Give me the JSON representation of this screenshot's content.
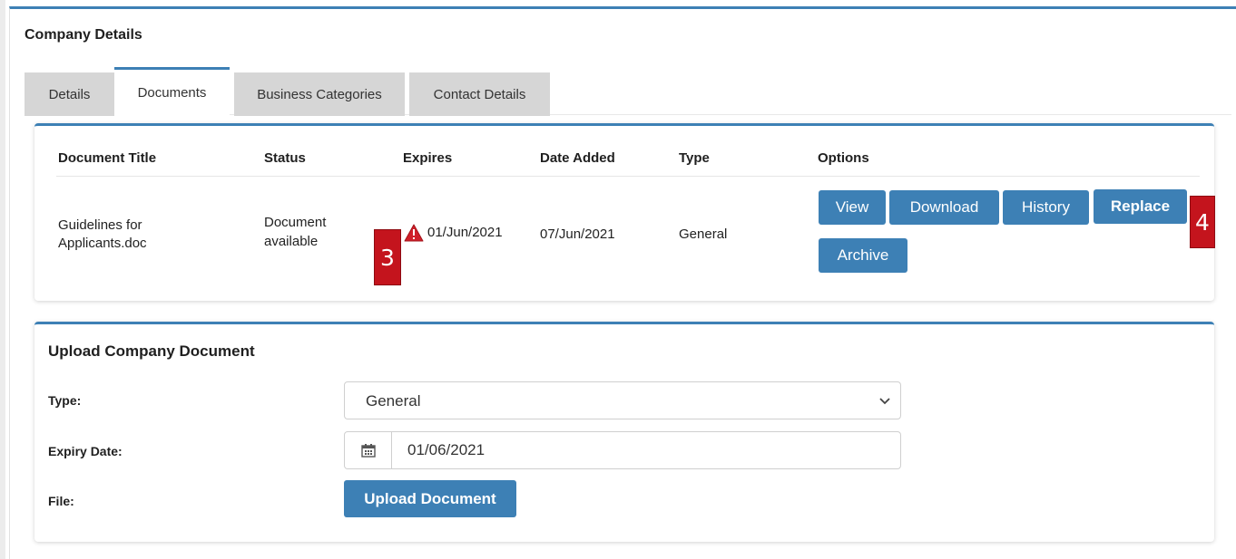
{
  "panel": {
    "title": "Company Details"
  },
  "tabs": [
    {
      "label": "Details",
      "active": false
    },
    {
      "label": "Documents",
      "active": true
    },
    {
      "label": "Business Categories",
      "active": false
    },
    {
      "label": "Contact Details",
      "active": false
    }
  ],
  "documents_table": {
    "headers": [
      "Document Title",
      "Status",
      "Expires",
      "Date Added",
      "Type",
      "Options"
    ],
    "rows": [
      {
        "title_line1": "Guidelines for",
        "title_line2": "Applicants.doc",
        "status_line1": "Document",
        "status_line2": "available",
        "expires": "01/Jun/2021",
        "expires_icon": "warning-triangle-icon",
        "date_added": "07/Jun/2021",
        "type": "General",
        "options": [
          "View",
          "Download",
          "History",
          "Replace",
          "Archive"
        ]
      }
    ]
  },
  "markers": [
    "3",
    "4"
  ],
  "upload": {
    "title": "Upload Company Document",
    "type_label": "Type:",
    "type_value": "General",
    "expiry_label": "Expiry Date:",
    "expiry_value": "01/06/2021",
    "expiry_icon": "calendar-icon",
    "file_label": "File:",
    "upload_button": "Upload Document"
  },
  "colors": {
    "accent": "#3d80b5",
    "tab_inactive": "#d6d6d6",
    "marker": "#c4141d",
    "warning": "#d0202a"
  }
}
